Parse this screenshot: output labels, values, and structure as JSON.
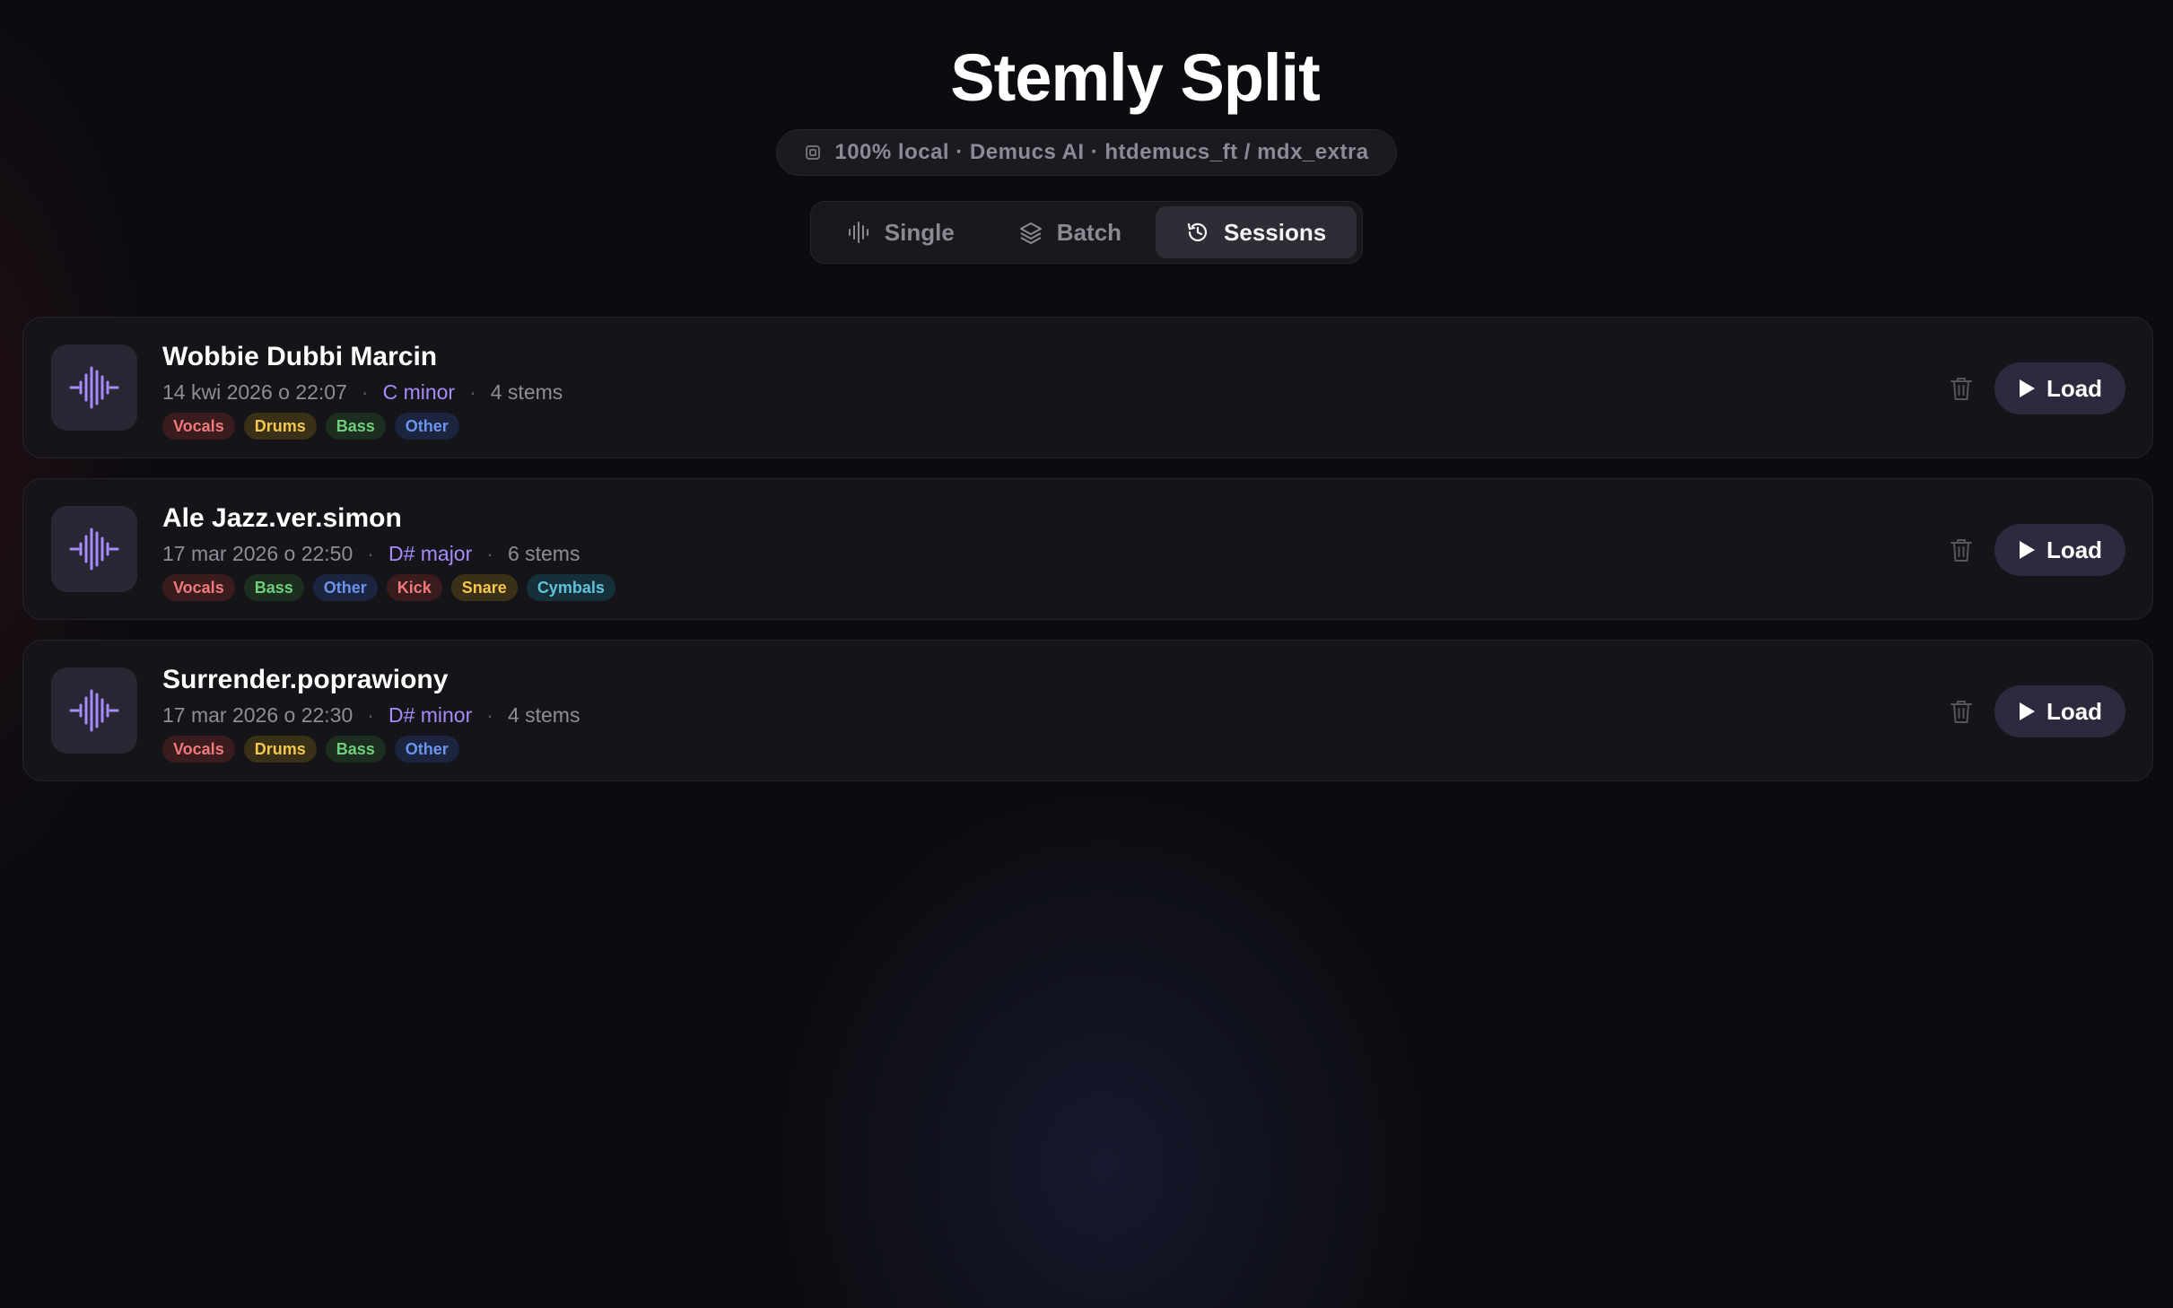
{
  "app": {
    "title": "Stemly Split",
    "logo_icon": "waveform-logo-icon",
    "badge_icon": "chip-icon",
    "badge_text": "100% local · Demucs AI · htdemucs_ft / mdx_extra"
  },
  "tabs": [
    {
      "label": "Single",
      "icon": "waveform-icon",
      "active": false
    },
    {
      "label": "Batch",
      "icon": "layers-icon",
      "active": false
    },
    {
      "label": "Sessions",
      "icon": "history-icon",
      "active": true
    }
  ],
  "sessions": [
    {
      "title": "Wobbie Dubbi Marcin",
      "date": "14 kwi 2026 o 22:07",
      "key": "C minor",
      "stems_count": "4 stems",
      "tags": [
        "Vocals",
        "Drums",
        "Bass",
        "Other"
      ],
      "load_label": "Load"
    },
    {
      "title": "Ale Jazz.ver.simon",
      "date": "17 mar 2026 o 22:50",
      "key": "D# major",
      "stems_count": "6 stems",
      "tags": [
        "Vocals",
        "Bass",
        "Other",
        "Kick",
        "Snare",
        "Cymbals"
      ],
      "load_label": "Load"
    },
    {
      "title": "Surrender.poprawiony",
      "date": "17 mar 2026 o 22:30",
      "key": "D# minor",
      "stems_count": "4 stems",
      "tags": [
        "Vocals",
        "Drums",
        "Bass",
        "Other"
      ],
      "load_label": "Load"
    }
  ],
  "colors": {
    "background": "#0c0c10",
    "accent_key": "#a78bfa",
    "load_button": "#2d2a40"
  }
}
